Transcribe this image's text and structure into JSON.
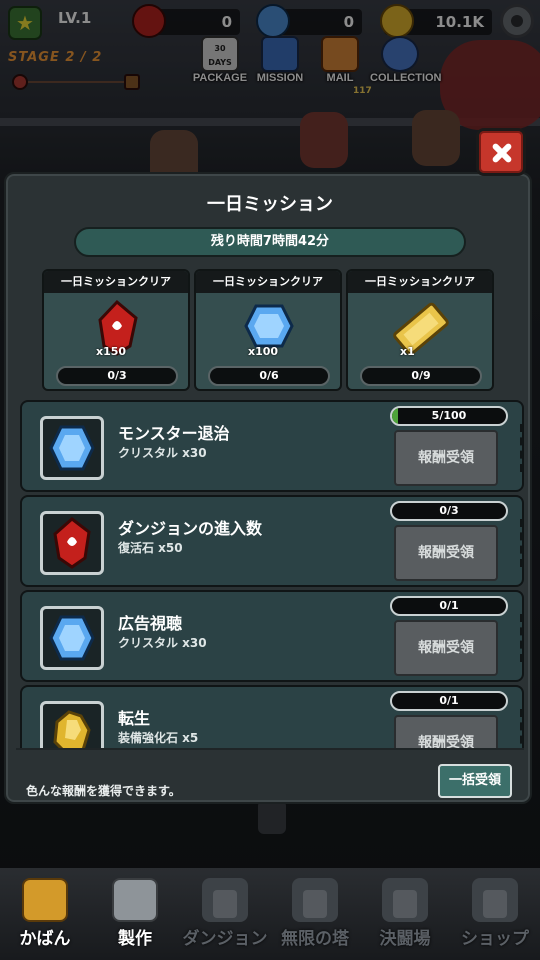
{
  "hud": {
    "level": "LV.1",
    "red_gem_count": "0",
    "crystal_count": "0",
    "coin_count": "10.1K",
    "stage": "STAGE 2 / 2"
  },
  "top_menu": [
    {
      "label": "PACKAGE",
      "badge": "30 DAYS"
    },
    {
      "label": "MISSION"
    },
    {
      "label": "MAIL",
      "count": "117"
    },
    {
      "label": "COLLECTION"
    }
  ],
  "modal": {
    "title": "一日ミッション",
    "timer": "残り時間7時間42分",
    "bonuses": [
      {
        "header": "一日ミッションクリア",
        "qty": "x150",
        "progress": "0/3",
        "icon": "red-gem-icon"
      },
      {
        "header": "一日ミッションクリア",
        "qty": "x100",
        "progress": "0/6",
        "icon": "crystal-icon"
      },
      {
        "header": "一日ミッションクリア",
        "qty": "x1",
        "progress": "0/9",
        "icon": "golden-ticket-icon"
      }
    ],
    "missions": [
      {
        "name": "モンスター退治",
        "reward": "クリスタル  x30",
        "progress": "5/100",
        "progress_fraction": 0.05,
        "claim": "報酬受領",
        "icon": "crystal-icon"
      },
      {
        "name": "ダンジョンの進入数",
        "reward": "復活石  x50",
        "progress": "0/3",
        "progress_fraction": 0,
        "claim": "報酬受領",
        "icon": "red-gem-icon"
      },
      {
        "name": "広告視聴",
        "reward": "クリスタル  x30",
        "progress": "0/1",
        "progress_fraction": 0,
        "claim": "報酬受領",
        "icon": "crystal-icon"
      },
      {
        "name": "転生",
        "reward": "装備強化石  x5",
        "progress": "0/1",
        "progress_fraction": 0,
        "claim": "報酬受領",
        "icon": "gold-ore-icon"
      }
    ],
    "hint": "色んな報酬を獲得できます。",
    "claim_all": "一括受領"
  },
  "bottom_nav": [
    {
      "label": "かばん",
      "locked": false
    },
    {
      "label": "製作",
      "locked": false
    },
    {
      "label": "ダンジョン",
      "locked": true
    },
    {
      "label": "無限の塔",
      "locked": true
    },
    {
      "label": "決闘場",
      "locked": true
    },
    {
      "label": "ショップ",
      "locked": true
    }
  ],
  "colors": {
    "panel": "#2b3234",
    "mission_card": "#2b4245",
    "timer_bar": "#2f5a55",
    "close_red": "#c6362b",
    "progress_green": "#4ea33a",
    "stage_orange": "#f49b3a"
  }
}
